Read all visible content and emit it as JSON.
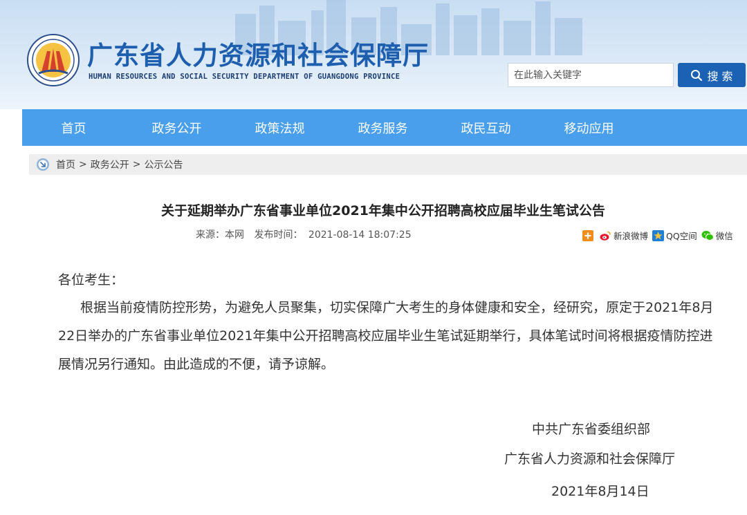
{
  "header": {
    "site_title": "广东省人力资源和社会保障厅",
    "site_subtitle": "HUMAN RESOURCES AND SOCIAL SECURITY DEPARTMENT OF GUANGDONG PROVINCE",
    "search_placeholder": "在此输入关键字",
    "search_button": "搜 索"
  },
  "nav": {
    "items": [
      "首页",
      "政务公开",
      "政策法规",
      "政务服务",
      "政民互动",
      "移动应用"
    ]
  },
  "breadcrumb": {
    "items": [
      "首页",
      "政务公开",
      "公示公告"
    ],
    "separator": ">"
  },
  "article": {
    "title": "关于延期举办广东省事业单位2021年集中公开招聘高校应届毕业生笔试公告",
    "source_label": "来源：本网",
    "date_label": "发布时间：",
    "date_value": "2021-08-14 18:07:25",
    "greeting": "各位考生：",
    "paragraph": "根据当前疫情防控形势，为避免人员聚集，切实保障广大考生的身体健康和安全，经研究，原定于2021年8月22日举办的广东省事业单位2021年集中公开招聘高校应届毕业生笔试延期举行，具体笔试时间将根据疫情防控进展情况另行通知。由此造成的不便，请予谅解。",
    "signature": [
      "中共广东省委组织部",
      "广东省人力资源和社会保障厅",
      "2021年8月14日"
    ]
  },
  "share": {
    "items": [
      "新浪微博",
      "QQ空间",
      "微信"
    ]
  },
  "colors": {
    "nav_bg": "#4a9fec",
    "title_blue": "#1d5fae",
    "search_btn": "#1b62b5"
  }
}
